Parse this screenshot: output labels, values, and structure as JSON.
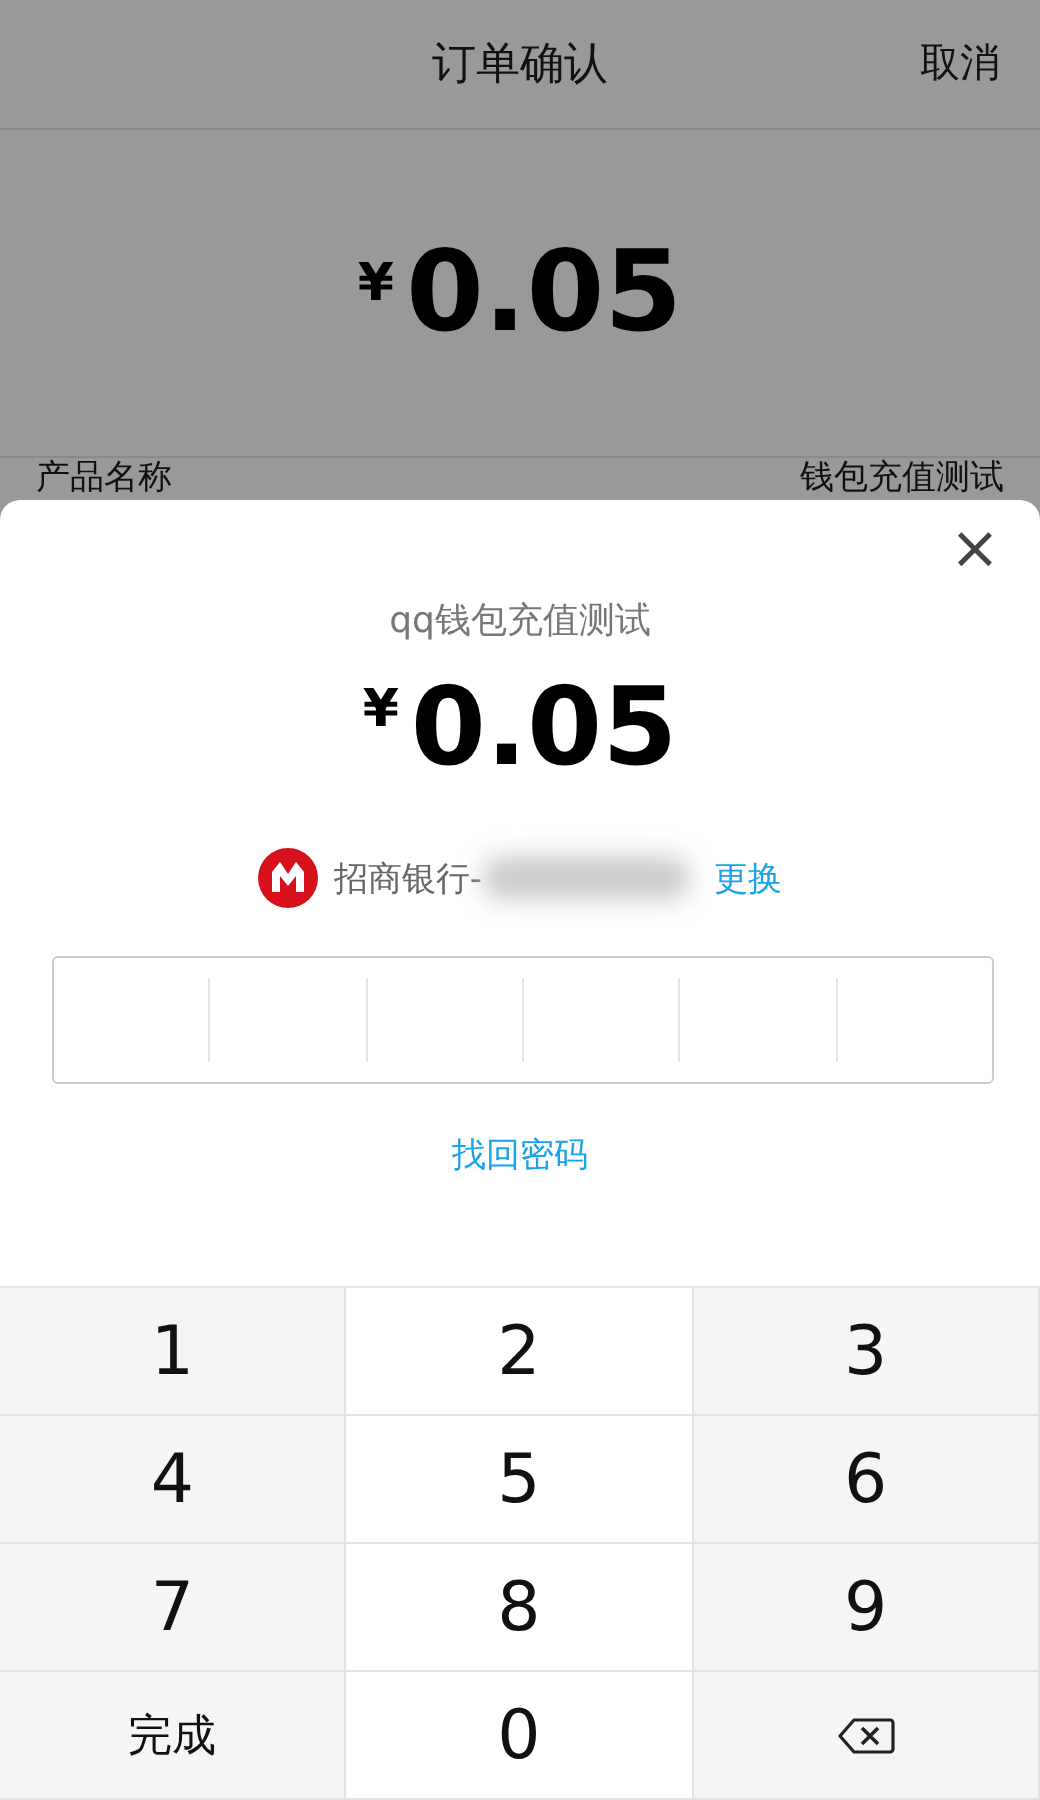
{
  "header": {
    "title": "订单确认",
    "cancel": "取消"
  },
  "order": {
    "currency": "¥",
    "amount": "0.05",
    "row_label": "产品名称",
    "row_value": "钱包充值测试"
  },
  "sheet": {
    "close": "×",
    "product": "qq钱包充值测试",
    "currency": "¥",
    "amount": "0.05",
    "bank": "招商银行-",
    "change": "更换",
    "forgot": "找回密码",
    "pin_cells": [
      {
        "filled": false
      },
      {
        "filled": false
      },
      {
        "filled": false
      },
      {
        "filled": false
      },
      {
        "filled": false
      },
      {
        "filled": false
      }
    ]
  },
  "keypad": [
    {
      "kind": "digit",
      "label": "1"
    },
    {
      "kind": "digit",
      "label": "2"
    },
    {
      "kind": "digit",
      "label": "3"
    },
    {
      "kind": "digit",
      "label": "4"
    },
    {
      "kind": "digit",
      "label": "5"
    },
    {
      "kind": "digit",
      "label": "6"
    },
    {
      "kind": "digit",
      "label": "7"
    },
    {
      "kind": "digit",
      "label": "8"
    },
    {
      "kind": "digit",
      "label": "9"
    },
    {
      "kind": "done",
      "label": "完成"
    },
    {
      "kind": "digit",
      "label": "0"
    },
    {
      "kind": "delete"
    }
  ]
}
